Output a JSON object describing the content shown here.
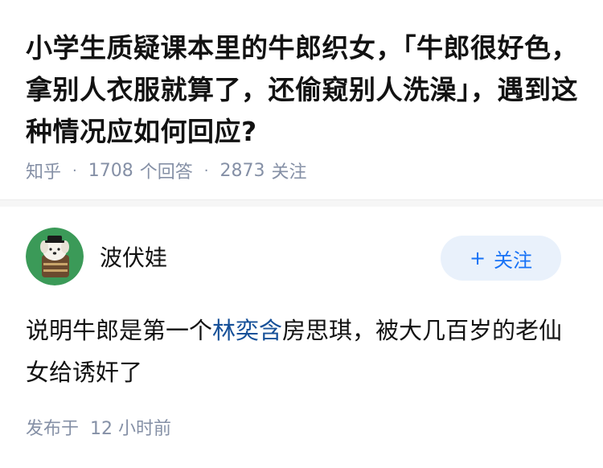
{
  "question": {
    "title": "小学生质疑课本里的牛郎织女，「牛郎很好色，拿别人衣服就算了，还偷窥别人洗澡」，遇到这种情况应如何回应?",
    "source": "知乎",
    "separator": "·",
    "answer_count": "1708",
    "answer_label": "个回答",
    "follower_count": "2873",
    "follower_label": "关注"
  },
  "answer": {
    "author": {
      "name": "波伏娃",
      "avatar_icon": "dog-avatar-icon"
    },
    "follow_button": {
      "plus": "+",
      "label": "关注"
    },
    "content": {
      "before": "说明牛郎是第一个",
      "link": "林奕含",
      "after": "房思琪，被大几百岁的老仙女给诱奸了"
    },
    "publish": {
      "label": "发布于",
      "time": "12 小时前"
    }
  },
  "colors": {
    "text": "#121212",
    "meta": "#8590a6",
    "accent": "#1772f6",
    "link": "#175199",
    "follow_bg": "#e9f1fb",
    "avatar_bg": "#3b9a58"
  }
}
